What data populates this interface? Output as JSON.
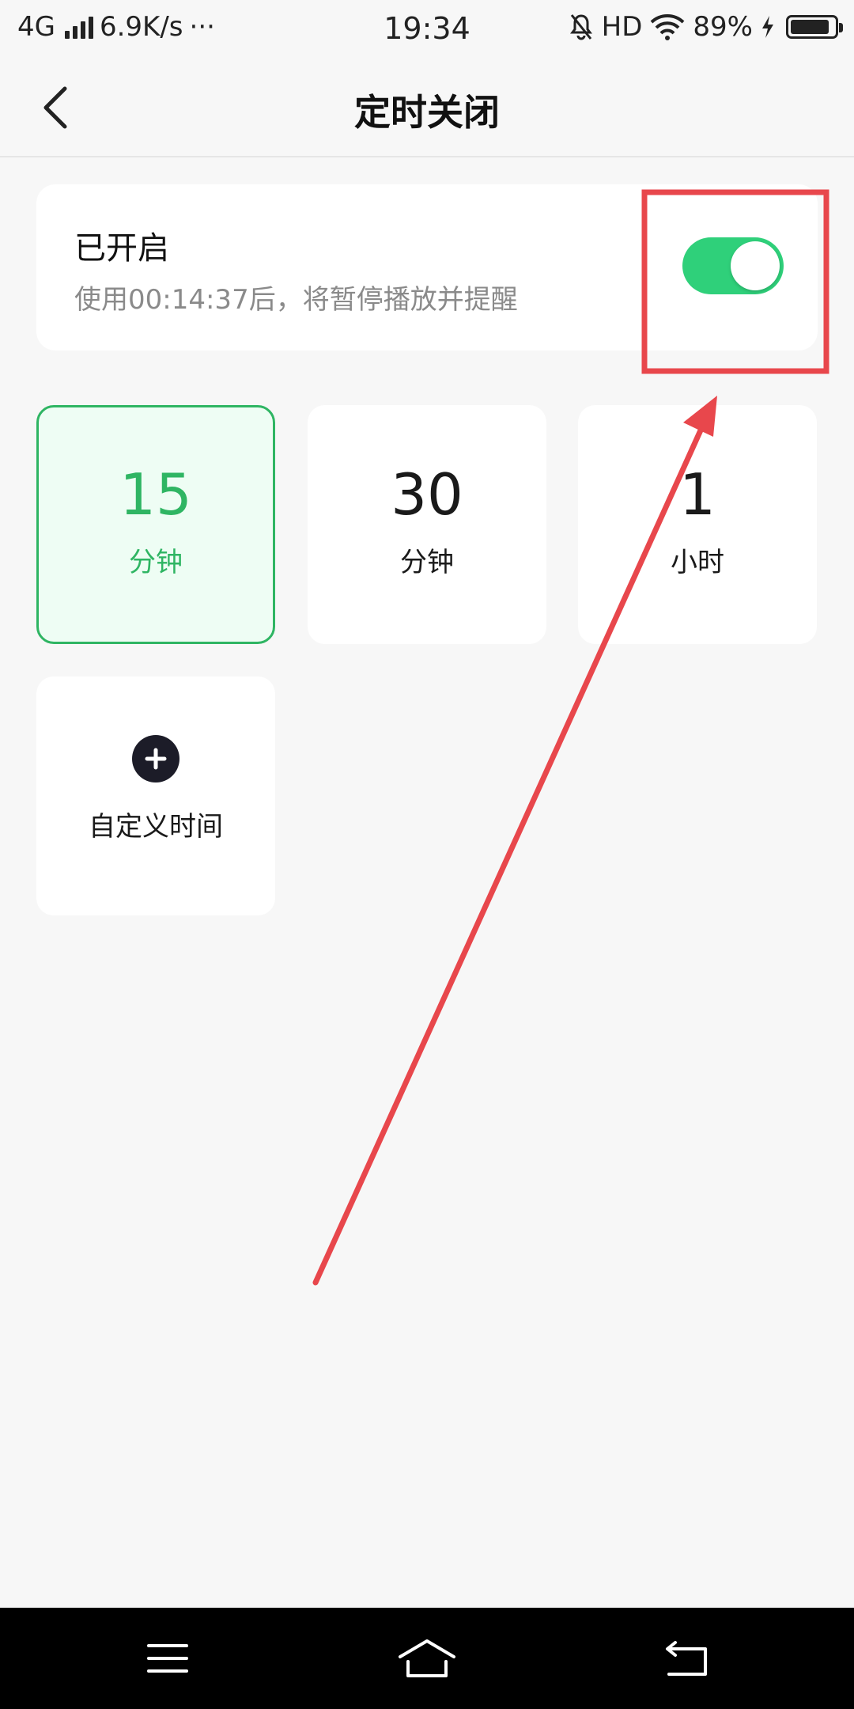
{
  "status_bar": {
    "network": "4G",
    "speed": "6.9K/s",
    "dots": "···",
    "time": "19:34",
    "hd": "HD",
    "battery_pct": "89%",
    "battery_level": 0.89
  },
  "header": {
    "title": "定时关闭"
  },
  "timer_status": {
    "title": "已开启",
    "description": "使用00:14:37后，将暂停播放并提醒",
    "enabled": true
  },
  "options": [
    {
      "value": "15",
      "unit": "分钟",
      "selected": true
    },
    {
      "value": "30",
      "unit": "分钟",
      "selected": false
    },
    {
      "value": "1",
      "unit": "小时",
      "selected": false
    }
  ],
  "custom_option": {
    "label": "自定义时间"
  },
  "colors": {
    "accent_green": "#2fb563",
    "toggle_green": "#2fd07a",
    "annotation_red": "#e8474c"
  },
  "icons": {
    "back": "back-arrow-icon",
    "add": "plus-icon",
    "nav_menu": "menu-icon",
    "nav_home": "home-icon",
    "nav_back": "return-icon"
  }
}
